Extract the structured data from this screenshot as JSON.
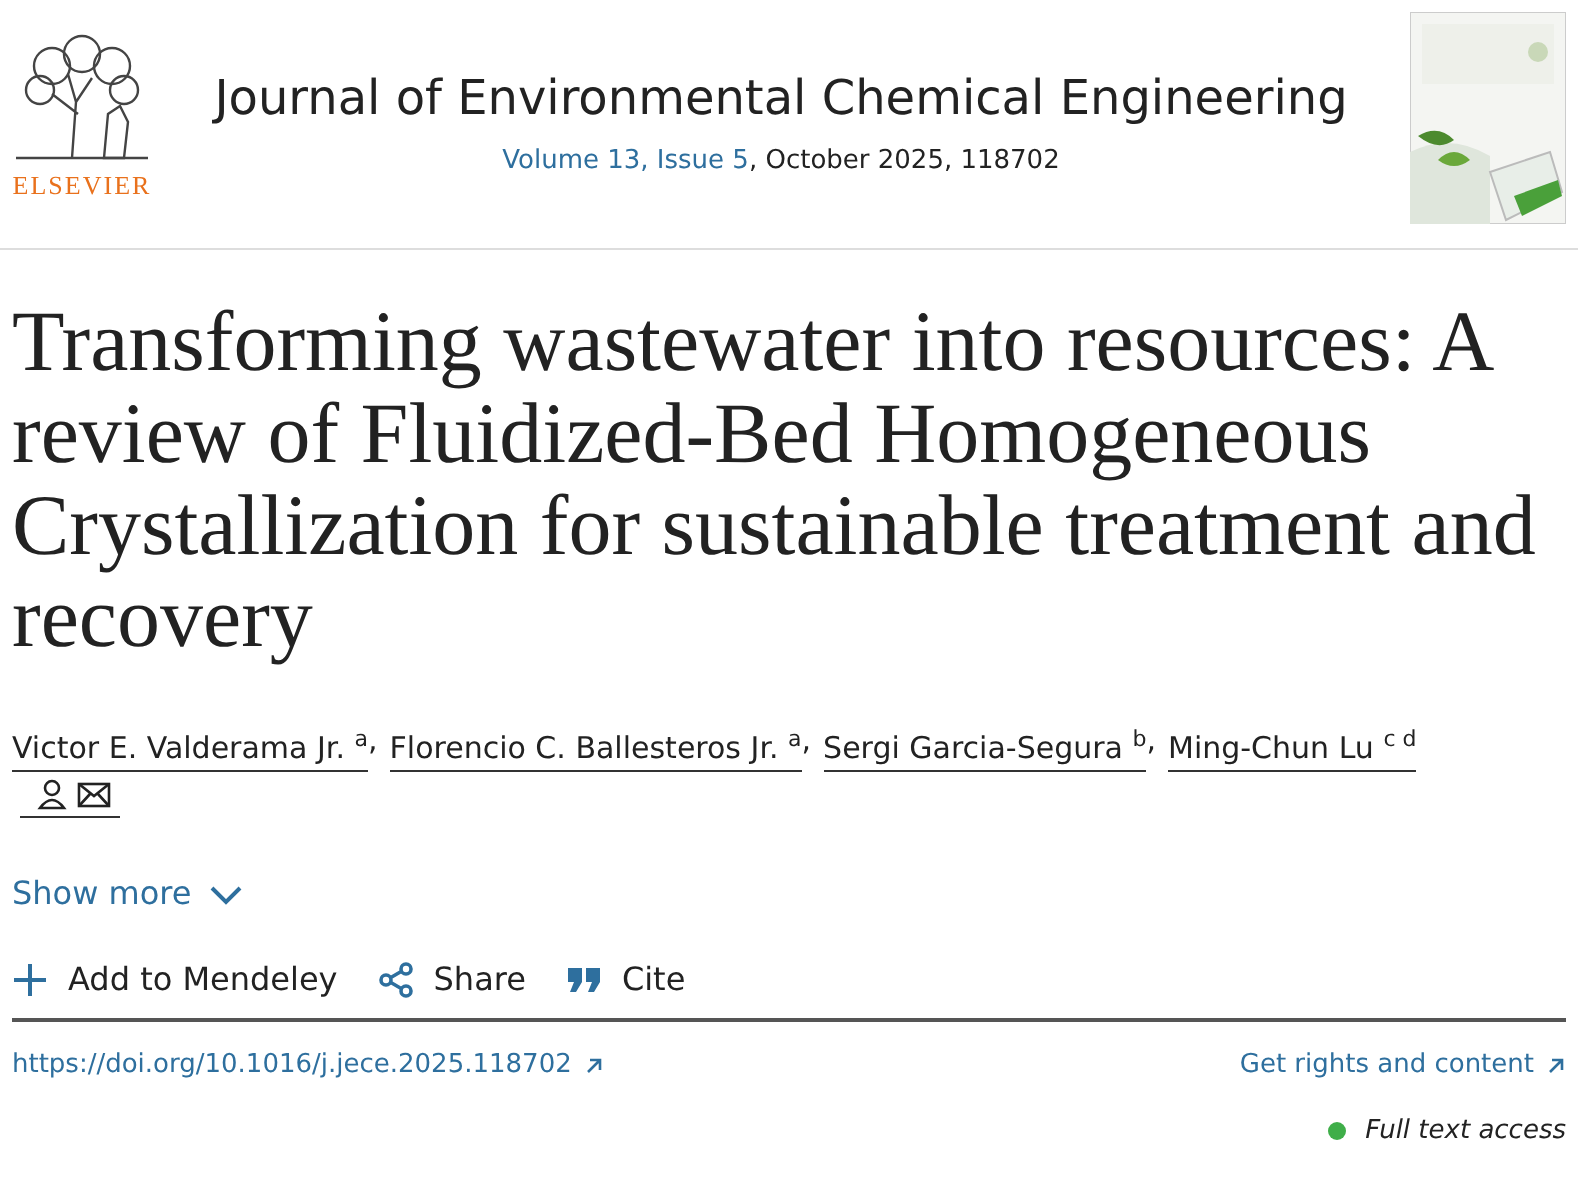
{
  "publisher": {
    "name": "ELSEVIER"
  },
  "journal": {
    "title": "Journal of Environmental Chemical Engineering",
    "issue_link": "Volume 13, Issue 5",
    "issue_rest": ", October 2025, 118702"
  },
  "article": {
    "title": "Transforming wastewater into resources: A review of Fluidized-Bed Homogeneous Crystallization for sustainable treatment and recovery"
  },
  "authors": [
    {
      "name": "Victor E. Valderama Jr. $^{a}$",
      "separator": ","
    },
    {
      "name": "Florencio C. Ballesteros Jr. $^{a}$",
      "separator": ","
    },
    {
      "name": "Sergi Garcia-Segura $^{b}$",
      "separator": ","
    },
    {
      "name": "Ming-Chun Lu $^{c d}$"
    }
  ],
  "show_more": {
    "label": "Show more",
    "expanded": false
  },
  "actions": [
    {
      "kind": "add",
      "label": "Add to Mendeley"
    },
    {
      "kind": "share",
      "label": "Share"
    },
    {
      "kind": "cite",
      "label": "Cite"
    }
  ],
  "doi": "https://doi.org/10.1016/j.jece.2025.118702",
  "rights": "Get rights and content",
  "access": {
    "label": "Full text access",
    "color": "#3fae49"
  }
}
